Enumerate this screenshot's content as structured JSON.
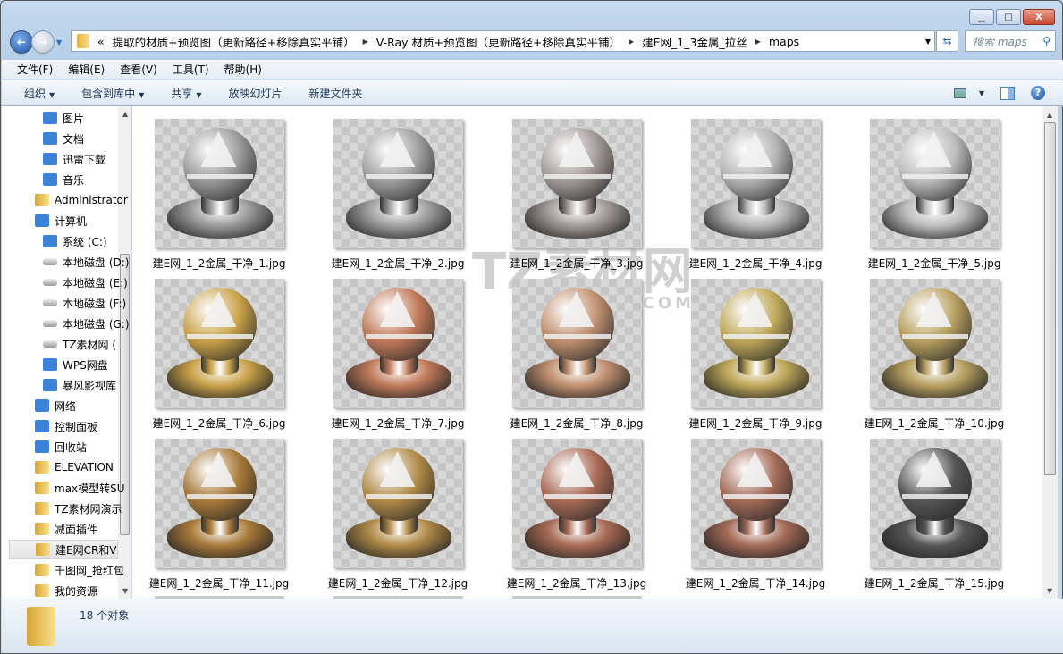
{
  "window": {
    "min": "▁",
    "max": "□",
    "close": "X"
  },
  "address": {
    "overflow": "«",
    "crumbs": [
      "提取的材质+预览图（更新路径+移除真实平铺）",
      "V-Ray 材质+预览图（更新路径+移除真实平铺）",
      "建E网_1_3金属_拉丝",
      "maps"
    ]
  },
  "search": {
    "placeholder": "搜索 maps"
  },
  "menu": [
    "文件(F)",
    "编辑(E)",
    "查看(V)",
    "工具(T)",
    "帮助(H)"
  ],
  "toolbar": {
    "organize": "组织",
    "include": "包含到库中",
    "share": "共享",
    "slideshow": "放映幻灯片",
    "new_folder": "新建文件夹"
  },
  "sidebar": [
    {
      "label": "图片",
      "icon": "pictures-icon"
    },
    {
      "label": "文档",
      "icon": "documents-icon"
    },
    {
      "label": "迅雷下载",
      "icon": "download-icon"
    },
    {
      "label": "音乐",
      "icon": "music-icon"
    },
    {
      "label": "Administrator",
      "icon": "user-folder-icon"
    },
    {
      "label": "计算机",
      "icon": "computer-icon"
    },
    {
      "label": "系统 (C:)",
      "icon": "system-drive-icon"
    },
    {
      "label": "本地磁盘 (D:)",
      "icon": "drive-icon"
    },
    {
      "label": "本地磁盘 (E:)",
      "icon": "drive-icon"
    },
    {
      "label": "本地磁盘 (F:)",
      "icon": "drive-icon"
    },
    {
      "label": "本地磁盘 (G:)",
      "icon": "drive-icon"
    },
    {
      "label": "TZ素材网 (",
      "icon": "drive-icon"
    },
    {
      "label": "WPS网盘",
      "icon": "cloud-icon"
    },
    {
      "label": "暴风影视库",
      "icon": "video-library-icon"
    },
    {
      "label": "网络",
      "icon": "network-icon"
    },
    {
      "label": "控制面板",
      "icon": "control-panel-icon"
    },
    {
      "label": "回收站",
      "icon": "recycle-bin-icon"
    },
    {
      "label": "ELEVATION",
      "icon": "folder-icon"
    },
    {
      "label": "max模型转SU",
      "icon": "folder-icon"
    },
    {
      "label": "TZ素材网演示",
      "icon": "folder-icon"
    },
    {
      "label": "减面插件",
      "icon": "folder-icon"
    },
    {
      "label": "建E网CR和VR",
      "icon": "folder-icon",
      "selected": true
    },
    {
      "label": "千图网_抢红包",
      "icon": "folder-icon"
    },
    {
      "label": "我的资源",
      "icon": "folder-icon"
    }
  ],
  "files": [
    {
      "name": "建E网_1_2金属_干净_1.jpg",
      "tint": "#9a9a9a"
    },
    {
      "name": "建E网_1_2金属_干净_2.jpg",
      "tint": "#a0a0a0"
    },
    {
      "name": "建E网_1_2金属_干净_3.jpg",
      "tint": "#a39a98"
    },
    {
      "name": "建E网_1_2金属_干净_4.jpg",
      "tint": "#b5b5b5"
    },
    {
      "name": "建E网_1_2金属_干净_5.jpg",
      "tint": "#bdbdbd"
    },
    {
      "name": "建E网_1_2金属_干净_6.jpg",
      "tint": "#c9a24a"
    },
    {
      "name": "建E网_1_2金属_干净_7.jpg",
      "tint": "#c07a5a"
    },
    {
      "name": "建E网_1_2金属_干净_8.jpg",
      "tint": "#c09070"
    },
    {
      "name": "建E网_1_2金属_干净_9.jpg",
      "tint": "#bfa85a"
    },
    {
      "name": "建E网_1_2金属_干净_10.jpg",
      "tint": "#b8a060"
    },
    {
      "name": "建E网_1_2金属_干净_11.jpg",
      "tint": "#a87a3a"
    },
    {
      "name": "建E网_1_2金属_干净_12.jpg",
      "tint": "#b08a48"
    },
    {
      "name": "建E网_1_2金属_干净_13.jpg",
      "tint": "#a86a55"
    },
    {
      "name": "建E网_1_2金属_干净_14.jpg",
      "tint": "#a36a58"
    },
    {
      "name": "建E网_1_2金属_干净_15.jpg",
      "tint": "#555555"
    },
    {
      "name": "",
      "tint": "#999999"
    },
    {
      "name": "",
      "tint": "#999999"
    },
    {
      "name": "",
      "tint": "#999999"
    }
  ],
  "watermark": {
    "text": "TZ素材网",
    "url": "TZSUCAI.COM"
  },
  "status": {
    "count": "18 个对象"
  }
}
